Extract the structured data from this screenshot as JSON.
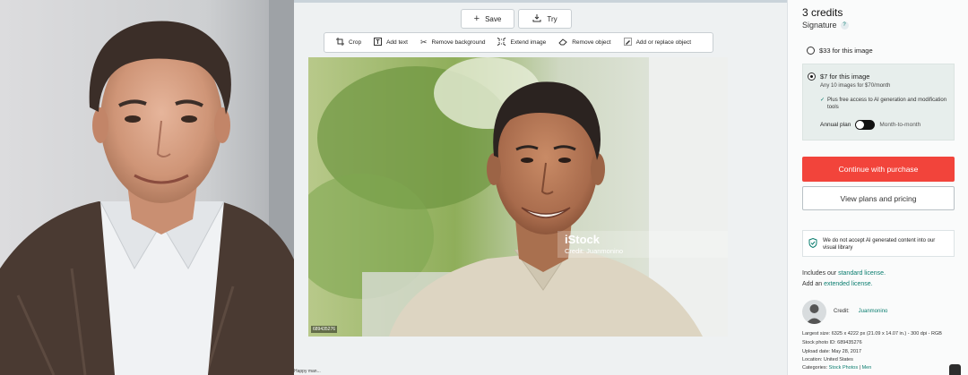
{
  "editor": {
    "save_label": "Save",
    "try_label": "Try",
    "tools": [
      {
        "label": "Crop",
        "icon": "crop-icon"
      },
      {
        "label": "Add text",
        "icon": "text-icon"
      },
      {
        "label": "Remove background",
        "icon": "scissors-icon"
      },
      {
        "label": "Extend image",
        "icon": "extend-icon"
      },
      {
        "label": "Remove object",
        "icon": "eraser-icon"
      },
      {
        "label": "Add or replace object",
        "icon": "edit-object-icon"
      }
    ],
    "photo_id": "689435276",
    "watermark_logo": "iStock",
    "watermark_credit": "Credit: Juanmonino",
    "bottom_caption": "Happy man..."
  },
  "purchase": {
    "credits_title": "3 credits",
    "license_name": "Signature",
    "help_glyph": "?",
    "option1_label": "$33 for this image",
    "option2_label": "$7 for this image",
    "option2_sub": "Any 10 images for $70/month",
    "option2_perk": "Plus free access to AI generation and modification tools",
    "annual_label": "Annual plan",
    "month_label": "Month-to-month",
    "continue_label": "Continue with purchase",
    "plans_label": "View plans and pricing",
    "ai_notice": "We do not accept AI generated content into our visual library",
    "includes_prefix": "Includes our ",
    "standard_license": "standard license.",
    "add_prefix": "Add an ",
    "extended_license": "extended license.",
    "credit_label": "Credit:",
    "credit_name": "Juanmonino",
    "largest_size": "Largest size: 6325 x 4222 px (21.09 x 14.07 in.) - 300 dpi - RGB",
    "stock_id": "Stock photo ID: 689435276",
    "upload_date": "Upload date: May 28, 2017",
    "location": "Location: United States",
    "categories_prefix": "Categories: ",
    "category1": "Stock Photos",
    "category2": "Men"
  },
  "colors": {
    "accent": "#0a7d6f",
    "cta": "#f2443b"
  }
}
